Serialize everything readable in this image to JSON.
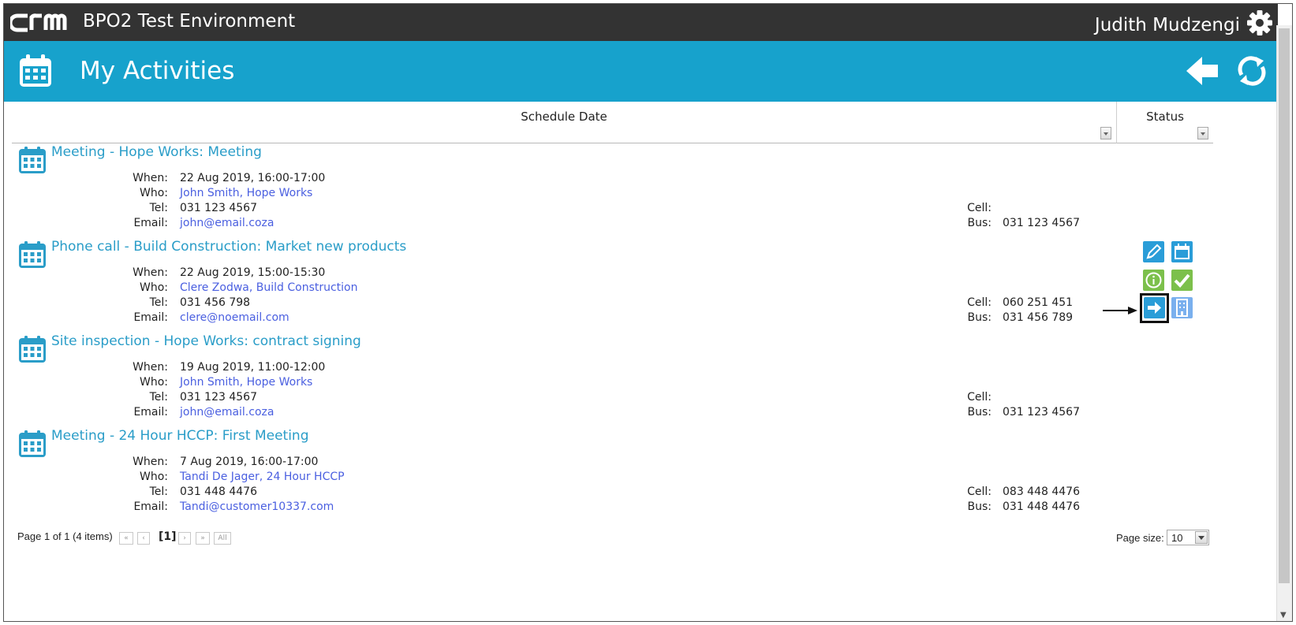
{
  "app": {
    "logo_text": "CRM",
    "environment": "BPO2 Test Environment",
    "user_name": "Judith Mudzengi"
  },
  "header": {
    "title": "My Activities"
  },
  "columns": {
    "schedule_date": "Schedule Date",
    "status": "Status"
  },
  "activities": [
    {
      "title": "Meeting - Hope Works: Meeting",
      "when": "22 Aug 2019, 16:00-17:00",
      "who": "John Smith, Hope Works",
      "tel": "031 123 4567",
      "email": "john@email.coza",
      "cell": "",
      "bus": "031 123 4567"
    },
    {
      "title": "Phone call - Build Construction: Market new products",
      "when": "22 Aug 2019, 15:00-15:30",
      "who": "Clere Zodwa, Build Construction",
      "tel": "031 456 798",
      "email": "clere@noemail.com",
      "cell": "060 251 451",
      "bus": "031 456 789"
    },
    {
      "title": "Site inspection - Hope Works: contract signing",
      "when": "19 Aug 2019, 11:00-12:00",
      "who": "John Smith, Hope Works",
      "tel": "031 123 4567",
      "email": "john@email.coza",
      "cell": "",
      "bus": "031 123 4567"
    },
    {
      "title": "Meeting - 24 Hour HCCP: First Meeting",
      "when": "7 Aug 2019, 16:00-17:00",
      "who": "Tandi De Jager, 24 Hour HCCP",
      "tel": "031 448 4476",
      "email": "Tandi@customer10337.com",
      "cell": "083 448 4476",
      "bus": "031 448 4476"
    }
  ],
  "labels": {
    "when": "When:",
    "who": "Who:",
    "tel": "Tel:",
    "email": "Email:",
    "cell": "Cell:",
    "bus": "Bus:"
  },
  "pager": {
    "summary": "Page 1 of 1 (4 items)",
    "first": "«",
    "prev": "‹",
    "current": "[1]",
    "next": "›",
    "last": "»",
    "all": "All",
    "page_size_label": "Page size:",
    "page_size": "10"
  },
  "icons": {
    "header": [
      "calendar-icon",
      "back-arrow-icon",
      "refresh-icon",
      "gear-icon"
    ],
    "row_actions": [
      "edit-icon",
      "calendar-icon",
      "info-icon",
      "complete-check-icon",
      "forward-arrow-icon",
      "company-building-icon"
    ]
  },
  "colors": {
    "top_bar": "#333333",
    "header_bar": "#17a2cc",
    "title_link": "#2a9dc8",
    "contact_link": "#4a5fe0",
    "icon_blue": "#2a9dd8",
    "icon_green": "#7cc04b",
    "icon_light_blue": "#7ab0ee"
  }
}
